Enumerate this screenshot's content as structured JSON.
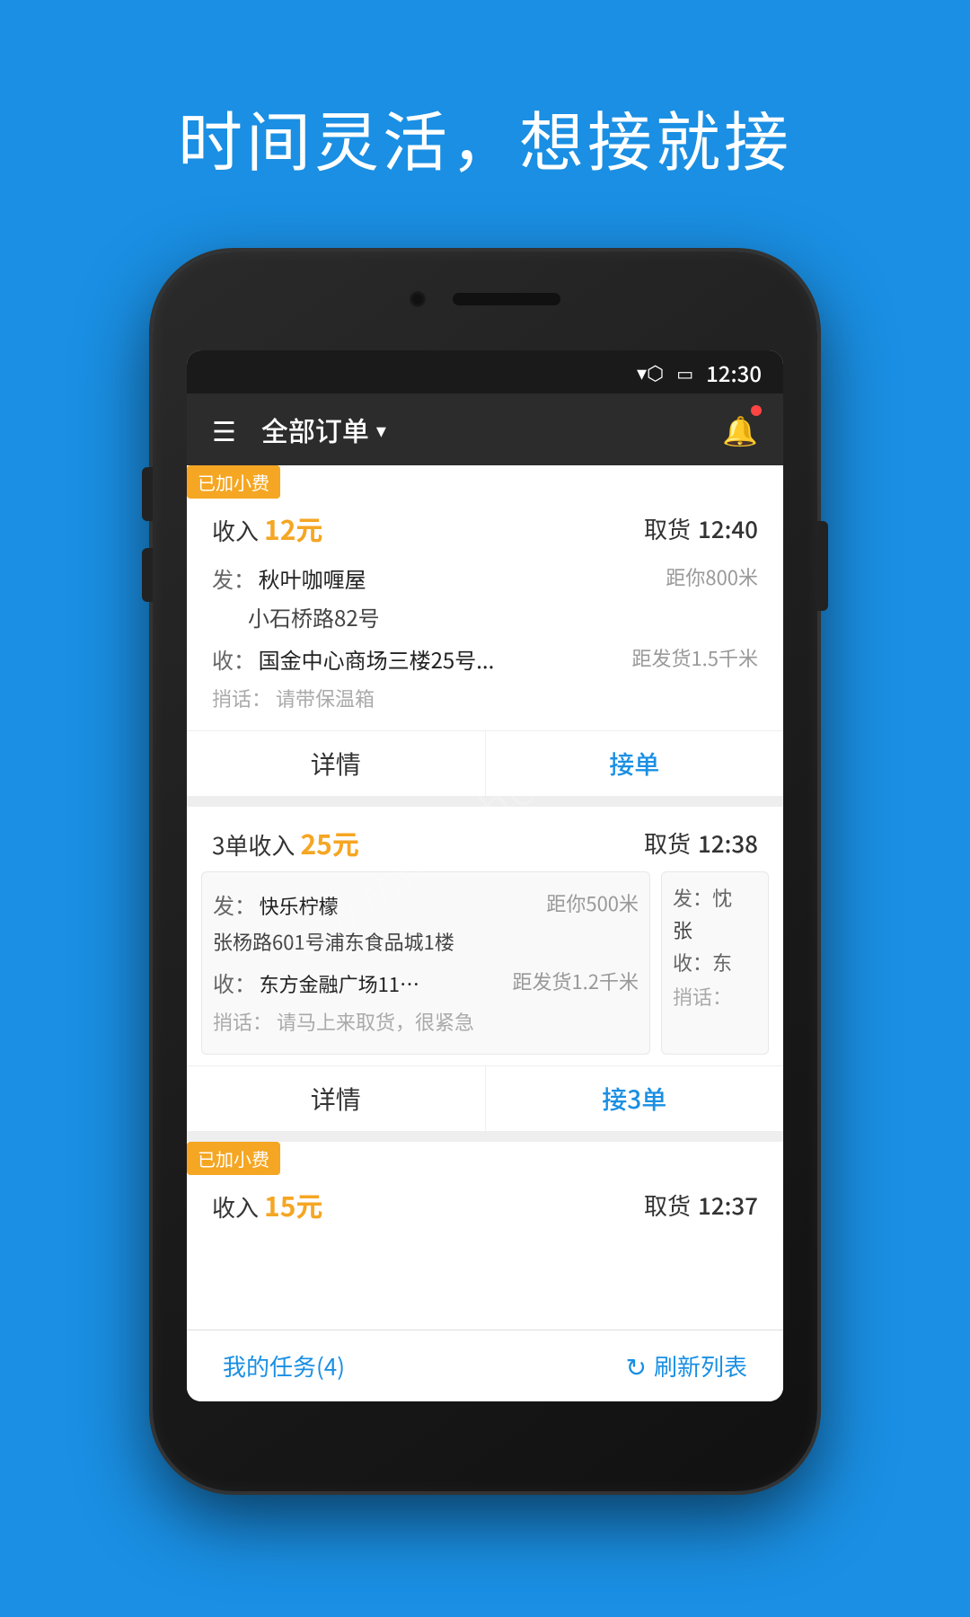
{
  "headline": "时间灵活，想接就接",
  "watermark": "www.hackhome.com",
  "status_bar": {
    "time": "12:30",
    "wifi_icon": "wifi",
    "battery_icon": "battery"
  },
  "app_bar": {
    "menu_icon": "☰",
    "title": "全部订单",
    "dropdown_icon": "▾",
    "notification_icon": "🔔"
  },
  "order1": {
    "badge": "已加小费",
    "income_label": "收入",
    "income_value": "12元",
    "pickup_label": "取货",
    "pickup_time": "12:40",
    "from_prefix": "发：",
    "from_name": "秋叶咖喱屋",
    "from_distance": "距你800米",
    "from_address": "小石桥路82号",
    "to_prefix": "收：",
    "to_name": "国金中心商场三楼25号...",
    "to_distance": "距发货1.5千米",
    "note_label": "捎话：",
    "note": "请带保温箱",
    "detail_btn": "详情",
    "accept_btn": "接单"
  },
  "order2": {
    "count_label": "3单收入",
    "income_value": "25元",
    "pickup_label": "取货",
    "pickup_time": "12:38",
    "card1": {
      "from_prefix": "发：",
      "from_name": "快乐柠檬",
      "from_distance": "距你500米",
      "from_address": "张杨路601号浦东食品城1楼",
      "to_prefix": "收：",
      "to_name": "东方金融广场11…",
      "to_distance": "距发货1.2千米",
      "note_label": "捎话：",
      "note": "请马上来取货，很紧急"
    },
    "card2": {
      "from_prefix": "发：忱",
      "from_address": "张",
      "to_prefix": "收：东",
      "note_label": "捎话："
    },
    "detail_btn": "详情",
    "accept_btn": "接3单"
  },
  "order3": {
    "badge": "已加小费",
    "income_label": "收入",
    "income_value": "15元",
    "pickup_label": "取货",
    "pickup_time": "12:37"
  },
  "bottom_bar": {
    "task_label": "我的任务(4)",
    "refresh_icon": "↻",
    "refresh_label": "刷新列表"
  }
}
